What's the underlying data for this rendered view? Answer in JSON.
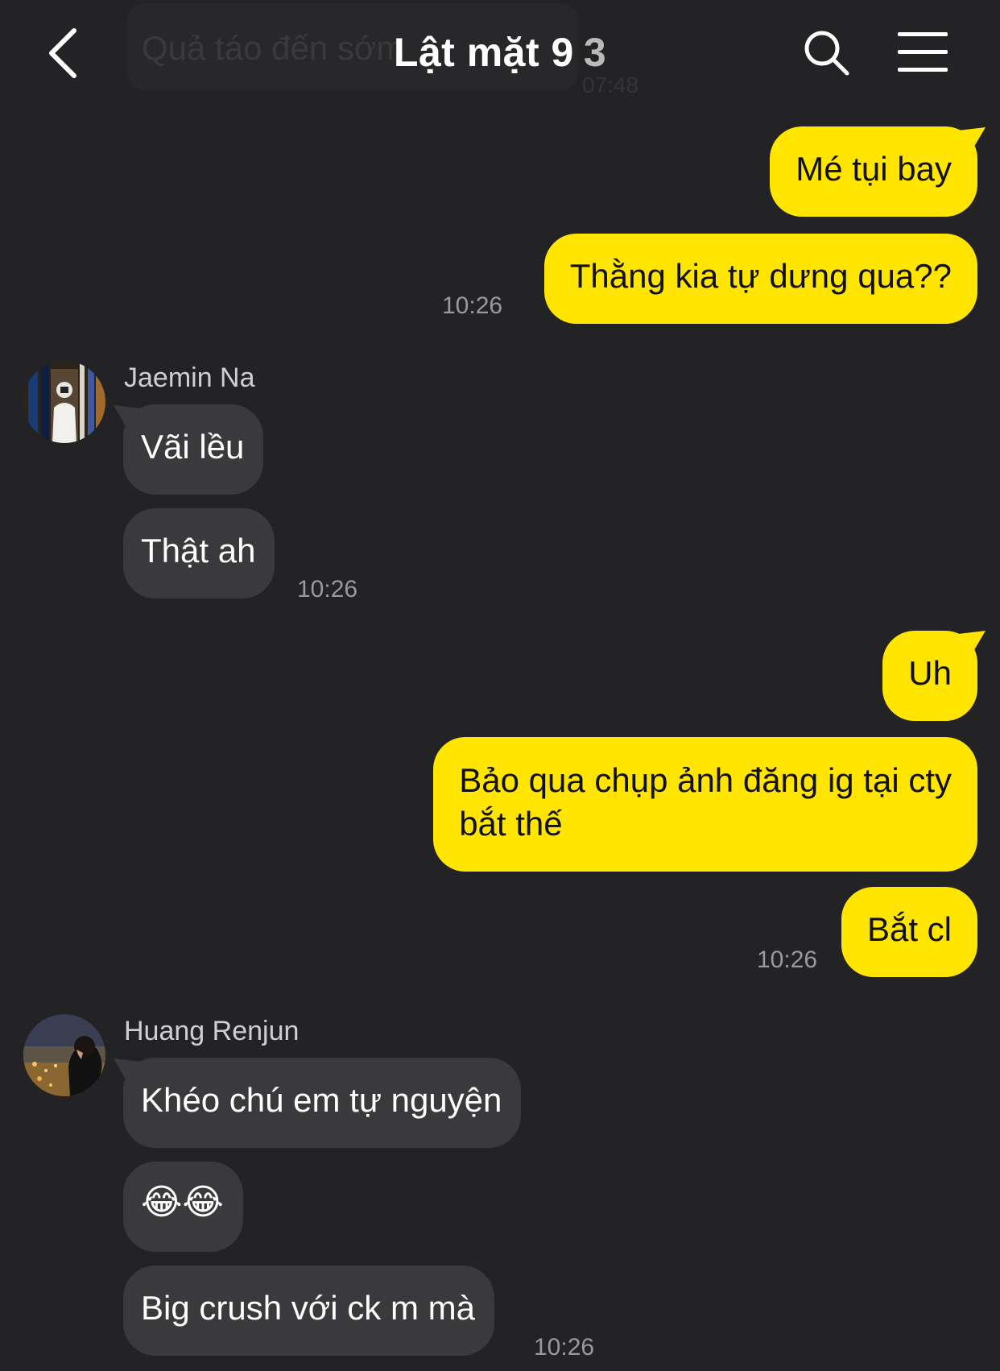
{
  "header": {
    "title": "Lật mặt 9",
    "member_count": "3",
    "preview_text": "Quả táo đến sớm",
    "preview_time": "07:48"
  },
  "icons": {
    "back": "chevron-left-icon",
    "search": "search-icon",
    "menu": "hamburger-menu-icon"
  },
  "colors": {
    "background": "#232325",
    "outgoing_bubble": "#ffe500",
    "incoming_bubble": "#3a3a3c"
  },
  "messages": [
    {
      "from": "me",
      "text": "Mé tụi bay"
    },
    {
      "from": "me",
      "text": "Thằng kia tự dưng qua??",
      "time": "10:26"
    },
    {
      "from": "Jaemin Na",
      "sender": "Jaemin Na",
      "text": "Vãi lều"
    },
    {
      "from": "Jaemin Na",
      "text": "Thật ah",
      "time": "10:26"
    },
    {
      "from": "me",
      "text": "Uh"
    },
    {
      "from": "me",
      "text_line1": "Bảo qua chụp ảnh đăng ig tại cty",
      "text_line2": "bắt thế"
    },
    {
      "from": "me",
      "text": "Bắt cl",
      "time": "10:26"
    },
    {
      "from": "Huang Renjun",
      "sender": "Huang Renjun",
      "text": "Khéo chú em tự nguyện"
    },
    {
      "from": "Huang Renjun",
      "text": "😂😂"
    },
    {
      "from": "Huang Renjun",
      "text": "Big crush với ck m mà",
      "time": "10:26"
    }
  ]
}
